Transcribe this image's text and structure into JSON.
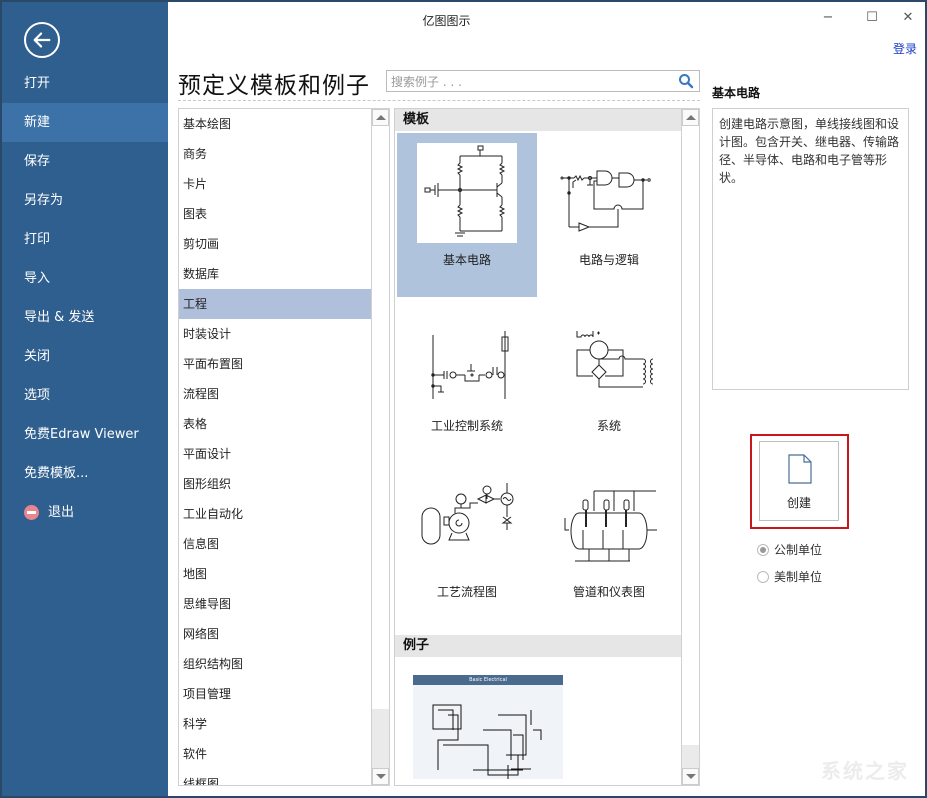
{
  "app": {
    "title": "亿图图示",
    "login": "登录"
  },
  "window_controls": {
    "minimize": "−",
    "maximize": "☐",
    "close": "✕"
  },
  "sidebar": {
    "back_icon": "arrow-left-circle-icon",
    "items": [
      {
        "label": "打开",
        "active": false
      },
      {
        "label": "新建",
        "active": true
      },
      {
        "label": "保存",
        "active": false
      },
      {
        "label": "另存为",
        "active": false
      },
      {
        "label": "打印",
        "active": false
      },
      {
        "label": "导入",
        "active": false
      },
      {
        "label": "导出 & 发送",
        "active": false
      },
      {
        "label": "关闭",
        "active": false
      },
      {
        "label": "选项",
        "active": false
      },
      {
        "label": "免费Edraw Viewer",
        "active": false
      },
      {
        "label": "免费模板...",
        "active": false
      },
      {
        "label": "退出",
        "active": false,
        "icon": "exit-icon"
      }
    ]
  },
  "main": {
    "page_title": "预定义模板和例子",
    "search": {
      "placeholder": "搜索例子 . . .",
      "value": ""
    },
    "categories": [
      "基本绘图",
      "商务",
      "卡片",
      "图表",
      "剪切画",
      "数据库",
      "工程",
      "时装设计",
      "平面布置图",
      "流程图",
      "表格",
      "平面设计",
      "图形组织",
      "工业自动化",
      "信息图",
      "地图",
      "思维导图",
      "网络图",
      "组织结构图",
      "项目管理",
      "科学",
      "软件",
      "线框图"
    ],
    "selected_category": "工程",
    "templates_header": "模板",
    "templates": [
      {
        "label": "基本电路",
        "selected": true
      },
      {
        "label": "电路与逻辑",
        "selected": false
      },
      {
        "label": "工业控制系统",
        "selected": false
      },
      {
        "label": "系统",
        "selected": false
      },
      {
        "label": "工艺流程图",
        "selected": false
      },
      {
        "label": "管道和仪表图",
        "selected": false
      }
    ],
    "examples_header": "例子",
    "examples": [
      {
        "title": "Basic Electrical"
      }
    ]
  },
  "detail": {
    "title": "基本电路",
    "description": "创建电路示意图，单线接线图和设计图。包含开关、继电器、传输路径、半导体、电路和电子管等形状。",
    "create_label": "创建",
    "units": [
      {
        "label": "公制单位",
        "checked": true
      },
      {
        "label": "美制单位",
        "checked": false
      }
    ]
  },
  "watermark": "系统之家"
}
